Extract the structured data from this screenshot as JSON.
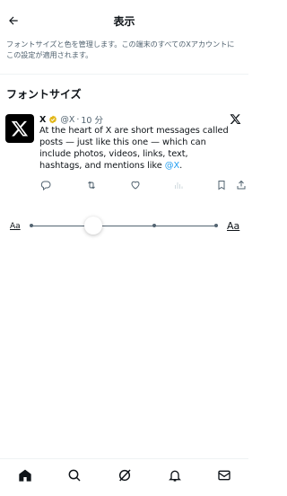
{
  "header": {
    "title": "表示",
    "back_icon": "arrow-left-icon"
  },
  "description": "フォントサイズと色を管理します。この端末のすべてのXアカウントにこの設定が適用されます。",
  "font_section": {
    "title": "フォントサイズ"
  },
  "tweet": {
    "name": "X",
    "handle": "@X",
    "separator": "·",
    "time": "10 分",
    "text": "At the heart of X are short messages called posts — just like this one — which can include photos, videos, links, text, hashtags, and mentions like ",
    "mention": "@X",
    "end": "."
  },
  "slider": {
    "small_label": "Aa",
    "large_label": "Aa",
    "steps": 5,
    "selected_index": 1
  },
  "tabbar": {
    "items": [
      "home-icon",
      "search-icon",
      "grok-icon",
      "bell-icon",
      "mail-icon"
    ]
  },
  "colors": {
    "text": "#0f1419",
    "secondary": "#536471",
    "accent": "#1d9bf0"
  }
}
